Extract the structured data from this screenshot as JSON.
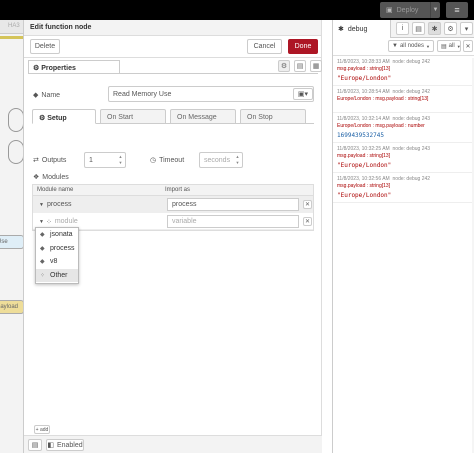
{
  "topbar": {
    "deploy_label": "Deploy",
    "menu_icon": "hamburger-icon"
  },
  "workspace": {
    "tab_label": "HA3",
    "node_labels": [
      "Use",
      "payload"
    ]
  },
  "tray": {
    "title": "Edit function node",
    "delete_label": "Delete",
    "cancel_label": "Cancel",
    "done_label": "Done",
    "properties_tab": "Properties",
    "name_label": "Name",
    "name_value": "Read Memory Use",
    "tabs": [
      "Setup",
      "On Start",
      "On Message",
      "On Stop"
    ],
    "outputs_label": "Outputs",
    "outputs_value": "1",
    "timeout_label": "Timeout",
    "timeout_placeholder": "seconds",
    "modules_label": "Modules",
    "modules_table": {
      "col_module": "Module name",
      "col_import": "Import as",
      "rows": [
        {
          "module": "process",
          "import_as": "process"
        },
        {
          "module": "module",
          "import_as": "variable"
        }
      ]
    },
    "dropdown_options": [
      "jsonata",
      "process",
      "v8",
      "Other"
    ],
    "add_label": "+ add",
    "enabled_label": "Enabled"
  },
  "sidebar": {
    "tab_label": "debug",
    "filter_all_nodes": "all nodes",
    "filter_all": "all",
    "messages": [
      {
        "time": "11/8/2023, 10:28:33 AM",
        "node": "node: debug 242",
        "payload": "msg.payload : string[13]",
        "value": "\"Europe/London\"",
        "numeric": false
      },
      {
        "time": "11/8/2023, 10:28:54 AM",
        "node": "node: debug 242",
        "payload": "Europe/London : msg.payload : string[13]",
        "value": "",
        "numeric": false
      },
      {
        "time": "11/8/2023, 10:32:14 AM",
        "node": "node: debug 243",
        "payload": "Europe/London : msg.payload : number",
        "value": "1699439532745",
        "numeric": true
      },
      {
        "time": "11/8/2023, 10:32:25 AM",
        "node": "node: debug 243",
        "payload": "msg.payload : string[13]",
        "value": "\"Europe/London\"",
        "numeric": false
      },
      {
        "time": "11/8/2023, 10:32:56 AM",
        "node": "node: debug 242",
        "payload": "msg.payload : string[13]",
        "value": "\"Europe/London\"",
        "numeric": false
      }
    ]
  }
}
